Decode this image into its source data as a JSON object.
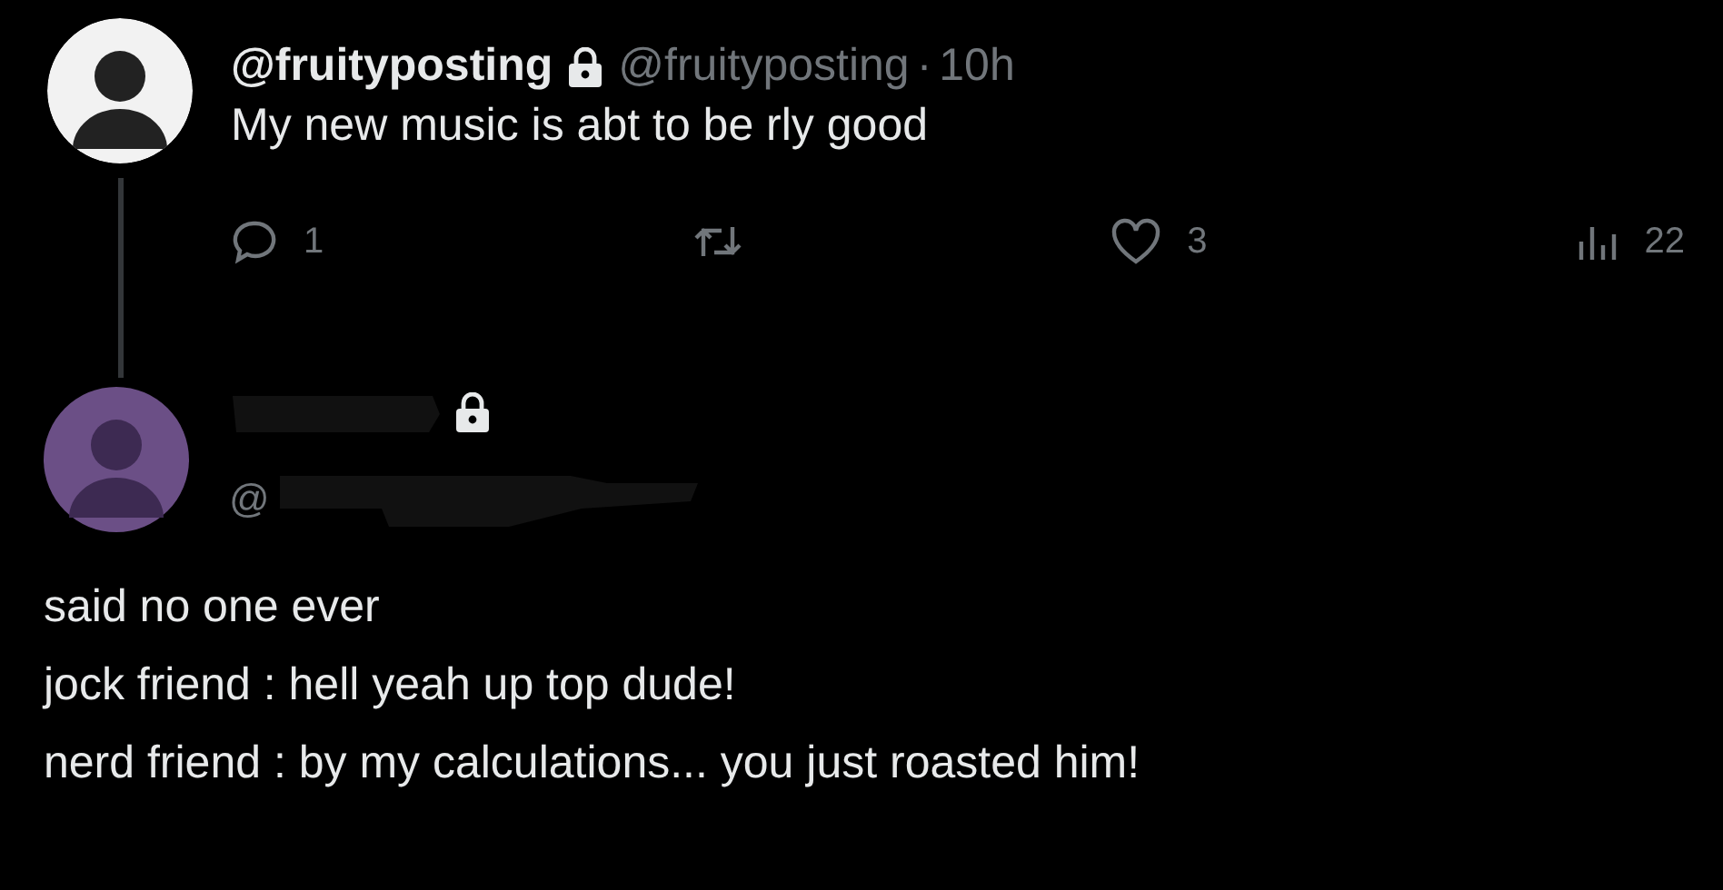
{
  "post": {
    "display_name": "@fruityposting",
    "locked": true,
    "handle": "@fruityposting",
    "separator": "·",
    "time": "10h",
    "text": "My new music is abt to be rly good",
    "actions": [
      {
        "kind": "reply",
        "count": "1"
      },
      {
        "kind": "repost"
      },
      {
        "kind": "like",
        "count": "3"
      },
      {
        "kind": "views",
        "count": "22"
      }
    ]
  },
  "reply": {
    "locked": true,
    "handle": "@",
    "lines": [
      "said no one ever",
      "jock friend : hell yeah up top dude!",
      "nerd friend : by my calculations... you just roasted him!"
    ]
  }
}
